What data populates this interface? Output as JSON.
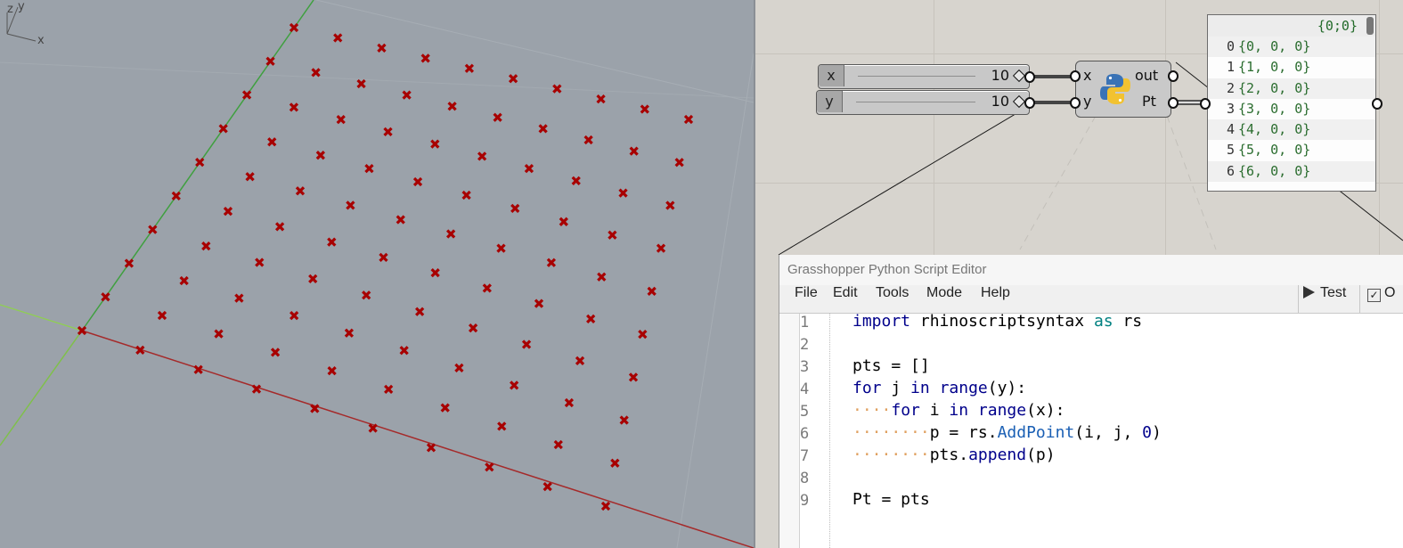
{
  "viewport": {
    "axis_labels": {
      "z": "z",
      "y": "y",
      "x": "x"
    },
    "colors": {
      "point": "#a80000",
      "x_axis": "#a52a2a",
      "y_axis": "#3c9a3c",
      "background": "#9ba2aa"
    }
  },
  "grasshopper": {
    "slider_x": {
      "label": "x",
      "value": "10"
    },
    "slider_y": {
      "label": "y",
      "value": "10"
    },
    "python_component": {
      "inputs": [
        "x",
        "y"
      ],
      "outputs": [
        "out",
        "Pt"
      ]
    },
    "panel": {
      "header": "{0;0}",
      "rows": [
        {
          "index": "0",
          "text": "{0, 0, 0}"
        },
        {
          "index": "1",
          "text": "{1, 0, 0}"
        },
        {
          "index": "2",
          "text": "{2, 0, 0}"
        },
        {
          "index": "3",
          "text": "{3, 0, 0}"
        },
        {
          "index": "4",
          "text": "{4, 0, 0}"
        },
        {
          "index": "5",
          "text": "{5, 0, 0}"
        },
        {
          "index": "6",
          "text": "{6, 0, 0}"
        }
      ]
    }
  },
  "editor": {
    "title": "Grasshopper Python Script Editor",
    "menu": [
      "File",
      "Edit",
      "Tools",
      "Mode",
      "Help"
    ],
    "test_label": "Test",
    "ok_label": "O",
    "line_numbers": [
      "1",
      "2",
      "3",
      "4",
      "5",
      "6",
      "7",
      "8",
      "9"
    ],
    "code": {
      "l1_kw1": "import",
      "l1_mod": " rhinoscriptsyntax ",
      "l1_kw2": "as",
      "l1_alias": " rs",
      "l3": "pts = []",
      "l4_for": "for",
      "l4_mid": " j ",
      "l4_in": "in",
      "l4_sp": " ",
      "l4_range": "range",
      "l4_arg": "(y):",
      "l5_dots": "····",
      "l5_for": "for",
      "l5_mid": " i ",
      "l5_in": "in",
      "l5_sp": " ",
      "l5_range": "range",
      "l5_arg": "(x):",
      "l6_dots": "········",
      "l6_a": "p = rs.",
      "l6_fn": "AddPoint",
      "l6_b": "(i, j, ",
      "l6_num": "0",
      "l6_c": ")",
      "l7_dots": "········",
      "l7_a": "pts.",
      "l7_fn": "append",
      "l7_b": "(p)",
      "l9": "Pt = pts"
    }
  }
}
